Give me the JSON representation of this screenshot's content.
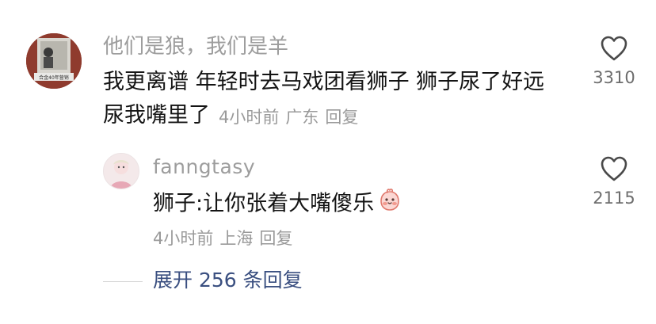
{
  "comment": {
    "username": "他们是狼，我们是羊",
    "body_line1": "我更离谱 年轻时去马戏团看狮子  狮子尿了好远",
    "body_line2": "尿我嘴里了",
    "time": "4小时前",
    "location": "广东",
    "reply_label": "回复",
    "likes": "3310",
    "avatar_caption": "合金40年营销"
  },
  "reply": {
    "username": "fanngtasy",
    "body": "狮子:让你张着大嘴傻乐",
    "emoji": "smiling-cheeks-icon",
    "time": "4小时前",
    "location": "上海",
    "reply_label": "回复",
    "likes": "2115"
  },
  "expand": {
    "label": "展开 256 条回复"
  },
  "colors": {
    "text": "#141414",
    "muted": "#9a9a9a",
    "link": "#3a4f80"
  }
}
